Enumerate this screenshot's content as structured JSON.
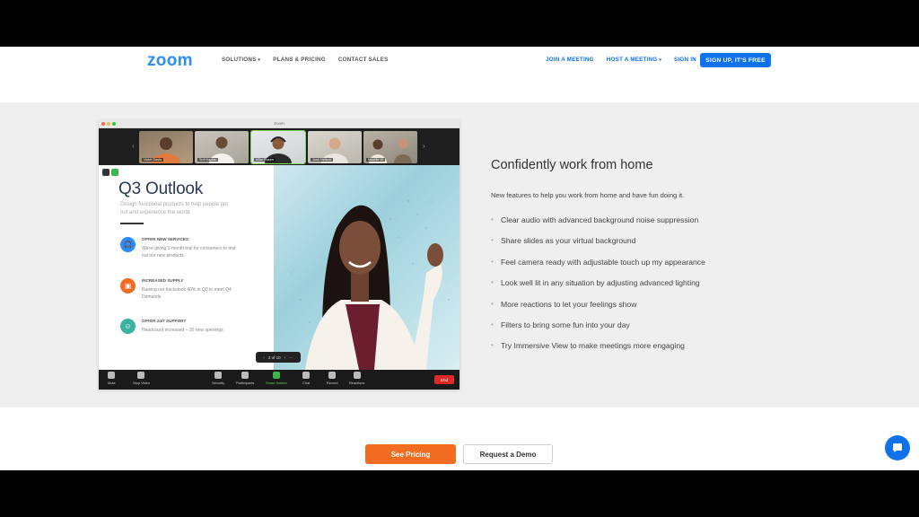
{
  "brand": {
    "logo": "zoom",
    "accent": "#0E72ED",
    "logo_color": "#2D8CFF",
    "cta_orange": "#F26D21"
  },
  "nav": {
    "left": [
      {
        "label": "SOLUTIONS",
        "has_caret": true
      },
      {
        "label": "PLANS & PRICING",
        "has_caret": false
      },
      {
        "label": "CONTACT SALES",
        "has_caret": false
      }
    ],
    "right": [
      {
        "label": "JOIN A MEETING",
        "has_caret": false
      },
      {
        "label": "HOST A MEETING",
        "has_caret": true
      },
      {
        "label": "SIGN IN",
        "has_caret": false
      }
    ],
    "signup": "SIGN UP, IT'S FREE"
  },
  "mock_window": {
    "title": "Zoom",
    "participants": [
      "Violet Davis",
      "Sofi Kaplan",
      "Mike Rosen",
      "Josh Nelson",
      "Maddie W"
    ],
    "slide": {
      "title": "Q3 Outlook",
      "subtitle": "Design functional products to help people get out and experience the world.",
      "items": [
        {
          "heading": "OFFER NEW SERVICES",
          "body": "We're giving 1-month trial for consumers to test out our new products.",
          "color": "#2D8CFF",
          "icon": "headphones-icon"
        },
        {
          "heading": "INCREASED SUPPLY",
          "body": "Raising our backstock 40% in Q3 to meet Q4 Demands",
          "color": "#F26D21",
          "icon": "box-icon"
        },
        {
          "heading": "OFFER 24/7 SUPPORT",
          "body": "Headcount increased – 20 new openings",
          "color": "#3BB3A3",
          "icon": "support-icon"
        }
      ]
    },
    "pager": "2 of 10",
    "toolbar": [
      "Mute",
      "Stop Video",
      "Security",
      "Participants",
      "Share Screen",
      "Chat",
      "Record",
      "Reactions"
    ],
    "end_label": "End"
  },
  "feature": {
    "heading": "Confidently work from home",
    "intro": "New features to help you work from home and have fun doing it.",
    "items": [
      "Clear audio with advanced background noise suppression",
      "Share slides as your virtual background",
      "Feel camera ready with adjustable touch up my appearance",
      "Look well lit in any situation by adjusting advanced lighting",
      "More reactions to let your feelings show",
      "Filters to bring some fun into your day",
      "Try Immersive View to make meetings more engaging"
    ]
  },
  "cta": {
    "pricing": "See Pricing",
    "demo": "Request a Demo"
  },
  "chat_widget": {
    "icon": "chat-bubble-icon"
  }
}
